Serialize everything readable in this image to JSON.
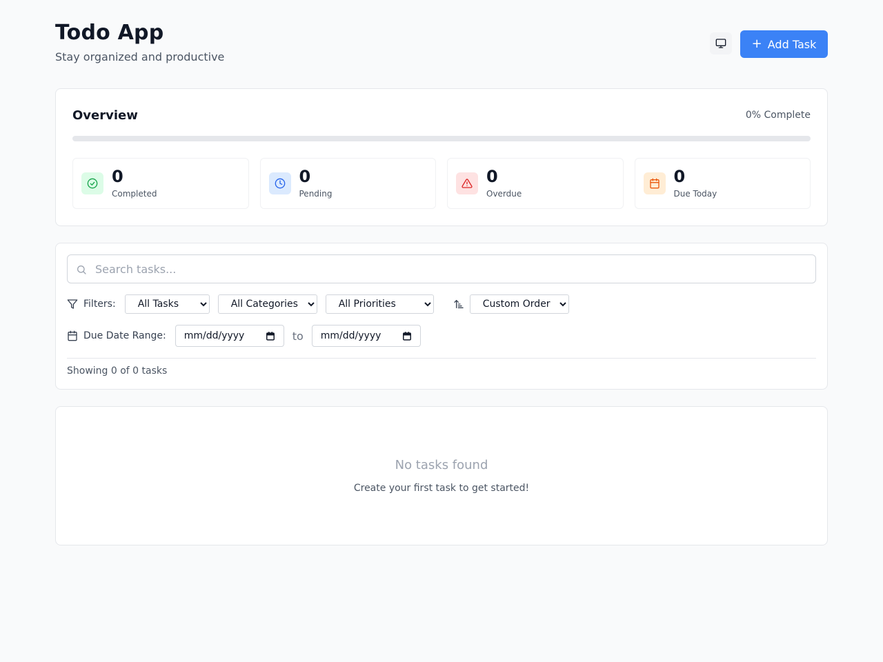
{
  "header": {
    "title": "Todo App",
    "subtitle": "Stay organized and productive",
    "theme_icon": "monitor-icon",
    "add_label": "Add Task",
    "add_icon": "+"
  },
  "overview": {
    "title": "Overview",
    "percent_label": "0% Complete",
    "progress": 0,
    "stats": [
      {
        "value": "0",
        "label": "Completed",
        "icon": "check-circle-icon",
        "color": "#16a34a",
        "bg": "#dcfce7"
      },
      {
        "value": "0",
        "label": "Pending",
        "icon": "clock-icon",
        "color": "#2563eb",
        "bg": "#dbeafe"
      },
      {
        "value": "0",
        "label": "Overdue",
        "icon": "alert-triangle-icon",
        "color": "#dc2626",
        "bg": "#fee2e2"
      },
      {
        "value": "0",
        "label": "Due Today",
        "icon": "calendar-icon",
        "color": "#ea580c",
        "bg": "#ffedd5"
      }
    ]
  },
  "filters": {
    "search_placeholder": "Search tasks...",
    "filters_label": "Filters:",
    "status_selected": "All Tasks",
    "category_selected": "All Categories",
    "priority_selected": "All Priorities",
    "sort_selected": "Custom Order",
    "date_label": "Due Date Range:",
    "date_from": "mm/dd/yyyy",
    "to_label": "to",
    "date_to": "mm/dd/yyyy",
    "showing": "Showing 0 of 0 tasks"
  },
  "empty": {
    "title": "No tasks found",
    "subtitle": "Create your first task to get started!"
  },
  "colors": {
    "accent": "#3b82f6"
  }
}
